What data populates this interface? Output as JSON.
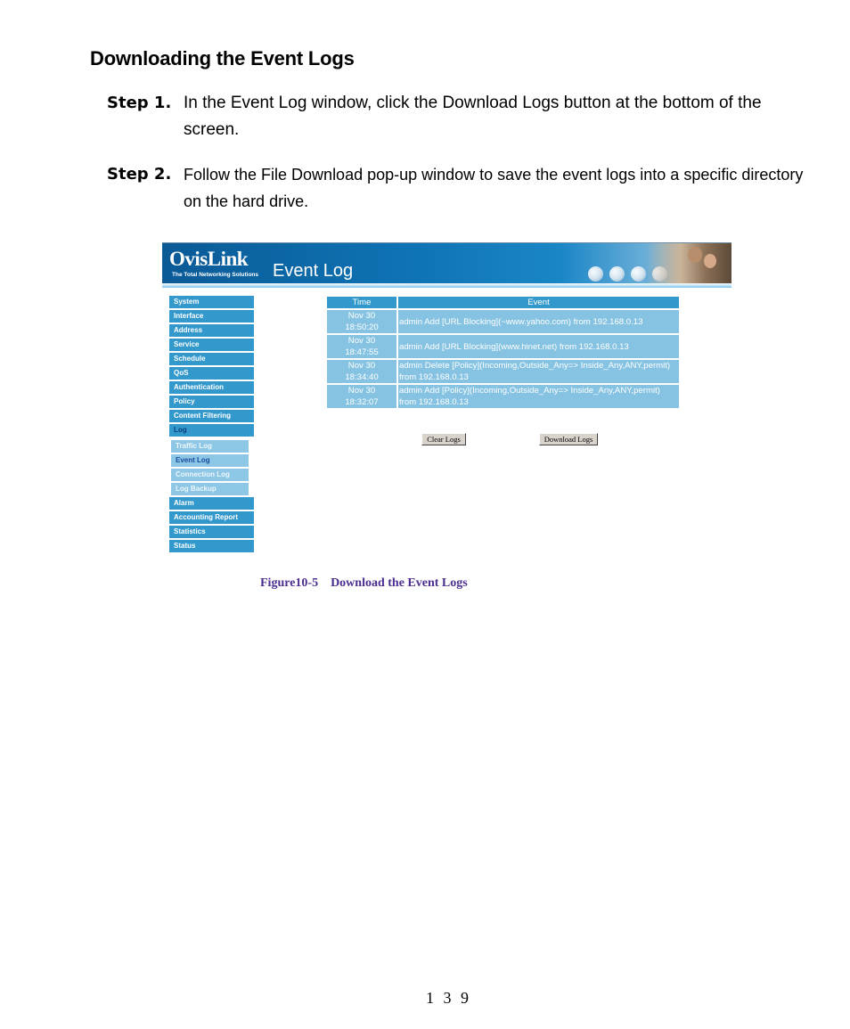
{
  "document": {
    "heading": "Downloading the Event Logs",
    "steps": [
      {
        "label": "Step 1.",
        "text": "In the Event Log window, click the Download Logs button at the bottom of the screen."
      },
      {
        "label": "Step 2.",
        "text": "Follow the File Download pop-up window to save the event logs into a specific directory on the hard drive."
      }
    ],
    "caption": "Figure10-5    Download the Event Logs",
    "page_number": "1 3 9"
  },
  "screenshot": {
    "brand": "OvisLink",
    "tagline": "The Total Networking Solutions",
    "page_title": "Event Log",
    "nav": {
      "items_top": [
        "System",
        "Interface",
        "Address",
        "Service",
        "Schedule",
        "QoS",
        "Authentication",
        "Policy",
        "Content Filtering"
      ],
      "active_parent": "Log",
      "sub_items": [
        "Traffic Log",
        "Event Log",
        "Connection Log",
        "Log Backup"
      ],
      "active_sub": "Event Log",
      "items_bottom": [
        "Alarm",
        "Accounting Report",
        "Statistics",
        "Status"
      ]
    },
    "table": {
      "headers": [
        "Time",
        "Event"
      ],
      "rows": [
        {
          "date": "Nov 30",
          "time": "18:50:20",
          "event": "admin Add [URL Blocking](~www.yahoo.com) from 192.168.0.13"
        },
        {
          "date": "Nov 30",
          "time": "18:47:55",
          "event": "admin Add [URL Blocking](www.hinet.net) from 192.168.0.13"
        },
        {
          "date": "Nov 30",
          "time": "18:34:40",
          "event": "admin Delete [Policy](Incoming,Outside_Any=> Inside_Any,ANY,permit) from 192.168.0.13"
        },
        {
          "date": "Nov 30",
          "time": "18:32:07",
          "event": "admin Add [Policy](Incoming,Outside_Any=> Inside_Any,ANY,permit) from 192.168.0.13"
        }
      ]
    },
    "buttons": {
      "clear": "Clear Logs",
      "download": "Download Logs"
    },
    "colors": {
      "nav_bg": "#3399cc",
      "sub_bg": "#8ec6e6",
      "row_bg": "#86c3e3",
      "caption": "#4b2e8f"
    }
  }
}
